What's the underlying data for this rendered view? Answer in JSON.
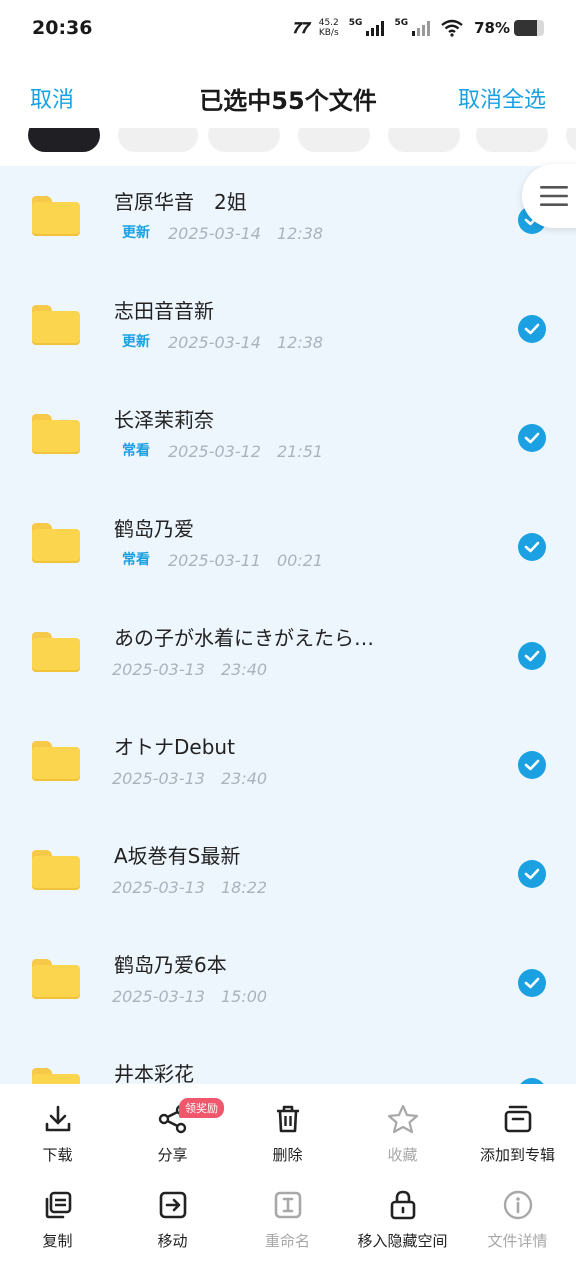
{
  "status_bar": {
    "time": "20:36",
    "speed_value": "45.2",
    "speed_unit": "KB/s",
    "network1": "5G",
    "network2": "5G",
    "battery": "78%"
  },
  "header": {
    "cancel_label": "取消",
    "title": "已选中55个文件",
    "deselect_all_label": "取消全选"
  },
  "files": [
    {
      "name": "宫原华音　2姐",
      "badge": "更新",
      "date": "2025-03-14　12:38",
      "checked": true
    },
    {
      "name": "志田音音新",
      "badge": "更新",
      "date": "2025-03-14　12:38",
      "checked": true
    },
    {
      "name": "长泽茉莉奈",
      "badge": "常看",
      "date": "2025-03-12　21:51",
      "checked": true
    },
    {
      "name": "鹤岛乃爱",
      "badge": "常看",
      "date": "2025-03-11　00:21",
      "checked": true
    },
    {
      "name": "あの子が水着にきがえたら…",
      "badge": "",
      "date": "2025-03-13　23:40",
      "checked": true
    },
    {
      "name": "オトナDebut",
      "badge": "",
      "date": "2025-03-13　23:40",
      "checked": true
    },
    {
      "name": "A坂巻有S最新",
      "badge": "",
      "date": "2025-03-13　18:22",
      "checked": true
    },
    {
      "name": "鹤岛乃爱6本",
      "badge": "",
      "date": "2025-03-13　15:00",
      "checked": true
    },
    {
      "name": "井本彩花",
      "badge": "",
      "date": "",
      "checked": true
    }
  ],
  "toolbar": {
    "row1": [
      {
        "label": "下载",
        "icon": "download-icon",
        "disabled": false
      },
      {
        "label": "分享",
        "icon": "share-icon",
        "disabled": false,
        "tag": "领奖励"
      },
      {
        "label": "删除",
        "icon": "trash-icon",
        "disabled": false
      },
      {
        "label": "收藏",
        "icon": "star-icon",
        "disabled": true
      },
      {
        "label": "添加到专辑",
        "icon": "album-icon",
        "disabled": false
      }
    ],
    "row2": [
      {
        "label": "复制",
        "icon": "copy-icon",
        "disabled": false
      },
      {
        "label": "移动",
        "icon": "move-icon",
        "disabled": false
      },
      {
        "label": "重命名",
        "icon": "rename-icon",
        "disabled": true
      },
      {
        "label": "移入隐藏空间",
        "icon": "lock-icon",
        "disabled": false
      },
      {
        "label": "文件详情",
        "icon": "info-icon",
        "disabled": true
      }
    ]
  },
  "colors": {
    "accent": "#1ba1e2",
    "list_bg": "#eef6fd",
    "folder": "#fcd54e",
    "reward_tag": "#f0576c"
  }
}
